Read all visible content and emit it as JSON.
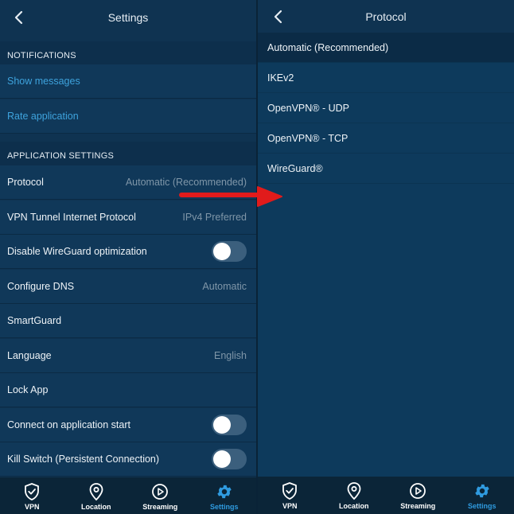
{
  "left": {
    "header": {
      "title": "Settings"
    },
    "notifications": {
      "section_label": "NOTIFICATIONS",
      "items": [
        {
          "label": "Show messages"
        },
        {
          "label": "Rate application"
        }
      ]
    },
    "app_settings": {
      "section_label": "APPLICATION SETTINGS",
      "items": [
        {
          "label": "Protocol",
          "value": "Automatic (Recommended)"
        },
        {
          "label": "VPN Tunnel Internet Protocol",
          "value": "IPv4 Preferred"
        },
        {
          "label": "Disable WireGuard optimization",
          "toggle": false
        },
        {
          "label": "Configure DNS",
          "value": "Automatic"
        },
        {
          "label": "SmartGuard"
        },
        {
          "label": "Language",
          "value": "English"
        },
        {
          "label": "Lock App"
        },
        {
          "label": "Connect on application start",
          "toggle": false
        },
        {
          "label": "Kill Switch (Persistent Connection)",
          "toggle": false
        }
      ]
    }
  },
  "right": {
    "header": {
      "title": "Protocol"
    },
    "options": [
      {
        "label": "Automatic (Recommended)",
        "selected": true
      },
      {
        "label": "IKEv2"
      },
      {
        "label": "OpenVPN® - UDP"
      },
      {
        "label": "OpenVPN® - TCP"
      },
      {
        "label": "WireGuard®"
      }
    ]
  },
  "tabs": [
    {
      "label": "VPN",
      "icon": "shield-check-icon"
    },
    {
      "label": "Location",
      "icon": "location-pin-icon"
    },
    {
      "label": "Streaming",
      "icon": "play-circle-icon"
    },
    {
      "label": "Settings",
      "icon": "gear-icon",
      "active": true
    }
  ],
  "colors": {
    "accent": "#2f9be0",
    "link": "#3ea3dd",
    "annotation_arrow": "#e11b1b"
  }
}
